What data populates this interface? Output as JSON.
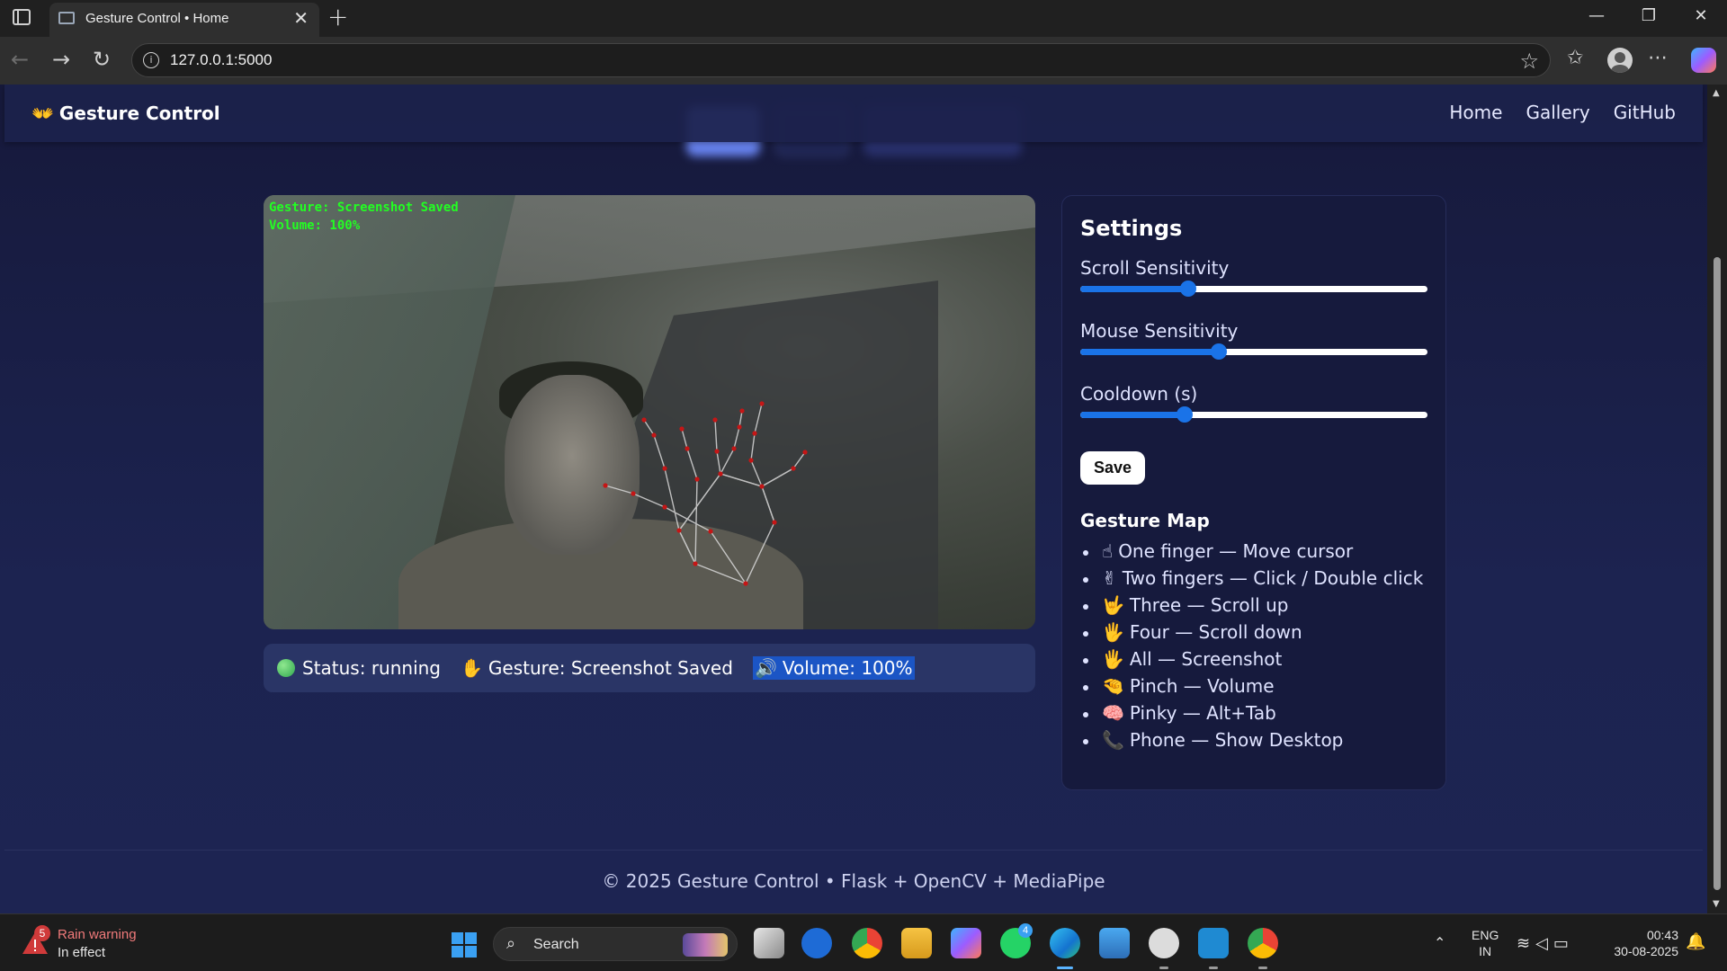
{
  "browser": {
    "tab_title": "Gesture Control • Home",
    "tab_close": "✕",
    "new_tab": "+",
    "url": "127.0.0.1:5000",
    "window_controls": {
      "minimize": "—",
      "restore": "❐",
      "close": "✕"
    },
    "icons": {
      "back": "←",
      "forward": "→",
      "reload": "↻",
      "info": "i",
      "favorite": "☆",
      "favorites": "✩",
      "more": "⋯"
    }
  },
  "site": {
    "brand_icon": "👐",
    "brand": "Gesture Control",
    "nav": [
      "Home",
      "Gallery",
      "GitHub"
    ]
  },
  "camera": {
    "overlay_gesture": "Gesture: Screenshot Saved",
    "overlay_volume": "Volume: 100%"
  },
  "status": {
    "status_text": "Status: running",
    "gesture_icon": "✋",
    "gesture_text": "Gesture: Screenshot Saved",
    "volume_icon": "🔊",
    "volume_text": "Volume: 100%"
  },
  "settings": {
    "title": "Settings",
    "sliders": [
      {
        "label": "Scroll Sensitivity",
        "value_fraction": 0.31
      },
      {
        "label": "Mouse Sensitivity",
        "value_fraction": 0.4
      },
      {
        "label": "Cooldown (s)",
        "value_fraction": 0.3
      }
    ],
    "save_label": "Save",
    "map_title": "Gesture Map",
    "gestures": [
      {
        "icon": "☝",
        "text": "One finger — Move cursor"
      },
      {
        "icon": "✌",
        "text": "Two fingers — Click / Double click"
      },
      {
        "icon": "🤟",
        "text": "Three — Scroll up"
      },
      {
        "icon": "🖐",
        "text": "Four — Scroll down"
      },
      {
        "icon": "🖐",
        "text": "All — Screenshot"
      },
      {
        "icon": "🤏",
        "text": "Pinch — Volume"
      },
      {
        "icon": "🧠",
        "text": "Pinky — Alt+Tab"
      },
      {
        "icon": "📞",
        "text": "Phone — Show Desktop"
      }
    ]
  },
  "footer": {
    "text": "© 2025 Gesture Control • Flask + OpenCV + MediaPipe"
  },
  "taskbar": {
    "weather_badge": "5",
    "weather_title": "Rain warning",
    "weather_sub": "In effect",
    "search_label": "Search",
    "whatsapp_badge": "4",
    "lang_line1": "ENG",
    "lang_line2": "IN",
    "time": "00:43",
    "date": "30-08-2025"
  },
  "colors": {
    "accent": "#1a73e8",
    "page_bg": "#1c2350",
    "status_dot": "#2fa84f",
    "camera_overlay_text": "#22ff22"
  }
}
